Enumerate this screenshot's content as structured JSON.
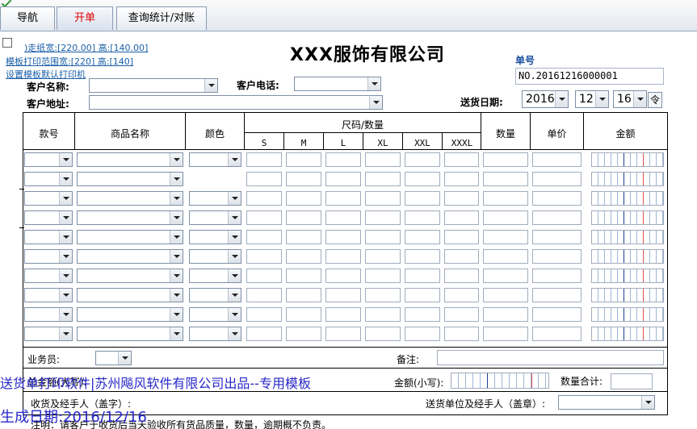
{
  "tabs": [
    {
      "label": "导航",
      "active": false
    },
    {
      "label": "开单",
      "active": true
    },
    {
      "label": "查询统计/对账",
      "active": false
    }
  ],
  "header": {
    "paper_size_link": ")走纸宽:[220.00] 高:[140.00]",
    "print_range_link": "模板打印范围宽:[220] 高:[140]",
    "default_printer_link": "设置模板默认打印机",
    "company_name": "XXX服饰有限公司",
    "customer_name_label": "客户名称:",
    "customer_phone_label": "客户电话:",
    "customer_address_label": "客户地址:",
    "order_no_label": "单号",
    "order_no_value": "NO.20161216000001",
    "delivery_date_label": "送货日期:",
    "date_year": "2016",
    "date_month": "12",
    "date_day": "16",
    "date_spin_glyph": "令"
  },
  "grid": {
    "columns": {
      "style_no": "款号",
      "product_name": "商品名称",
      "color": "颜色",
      "size_qty": "尺码/数量",
      "quantity": "数量",
      "unit_price": "单价",
      "amount": "金额"
    },
    "sizes": [
      "S",
      "M",
      "L",
      "XL",
      "XXL",
      "XXXL"
    ],
    "row_count": 10
  },
  "footer": {
    "salesperson_label": "业务员:",
    "remarks_label": "备注:",
    "total_amount_label": "金额(小写):",
    "total_amount_prefix": "总金额(大写):",
    "quantity_total_label": "数量合计:",
    "receiver_label": "收货及经手人（盖字）:",
    "sender_label": "送货单位及经手人（盖章）:",
    "note": "注明：请客户于收货后当天验收所有货品质量，数量，逾期概不负责。"
  },
  "watermark": {
    "line1": "送货单打印软件|苏州飚风软件有限公司出品--专用模板",
    "line2": "生成日期:2016/12/16"
  }
}
